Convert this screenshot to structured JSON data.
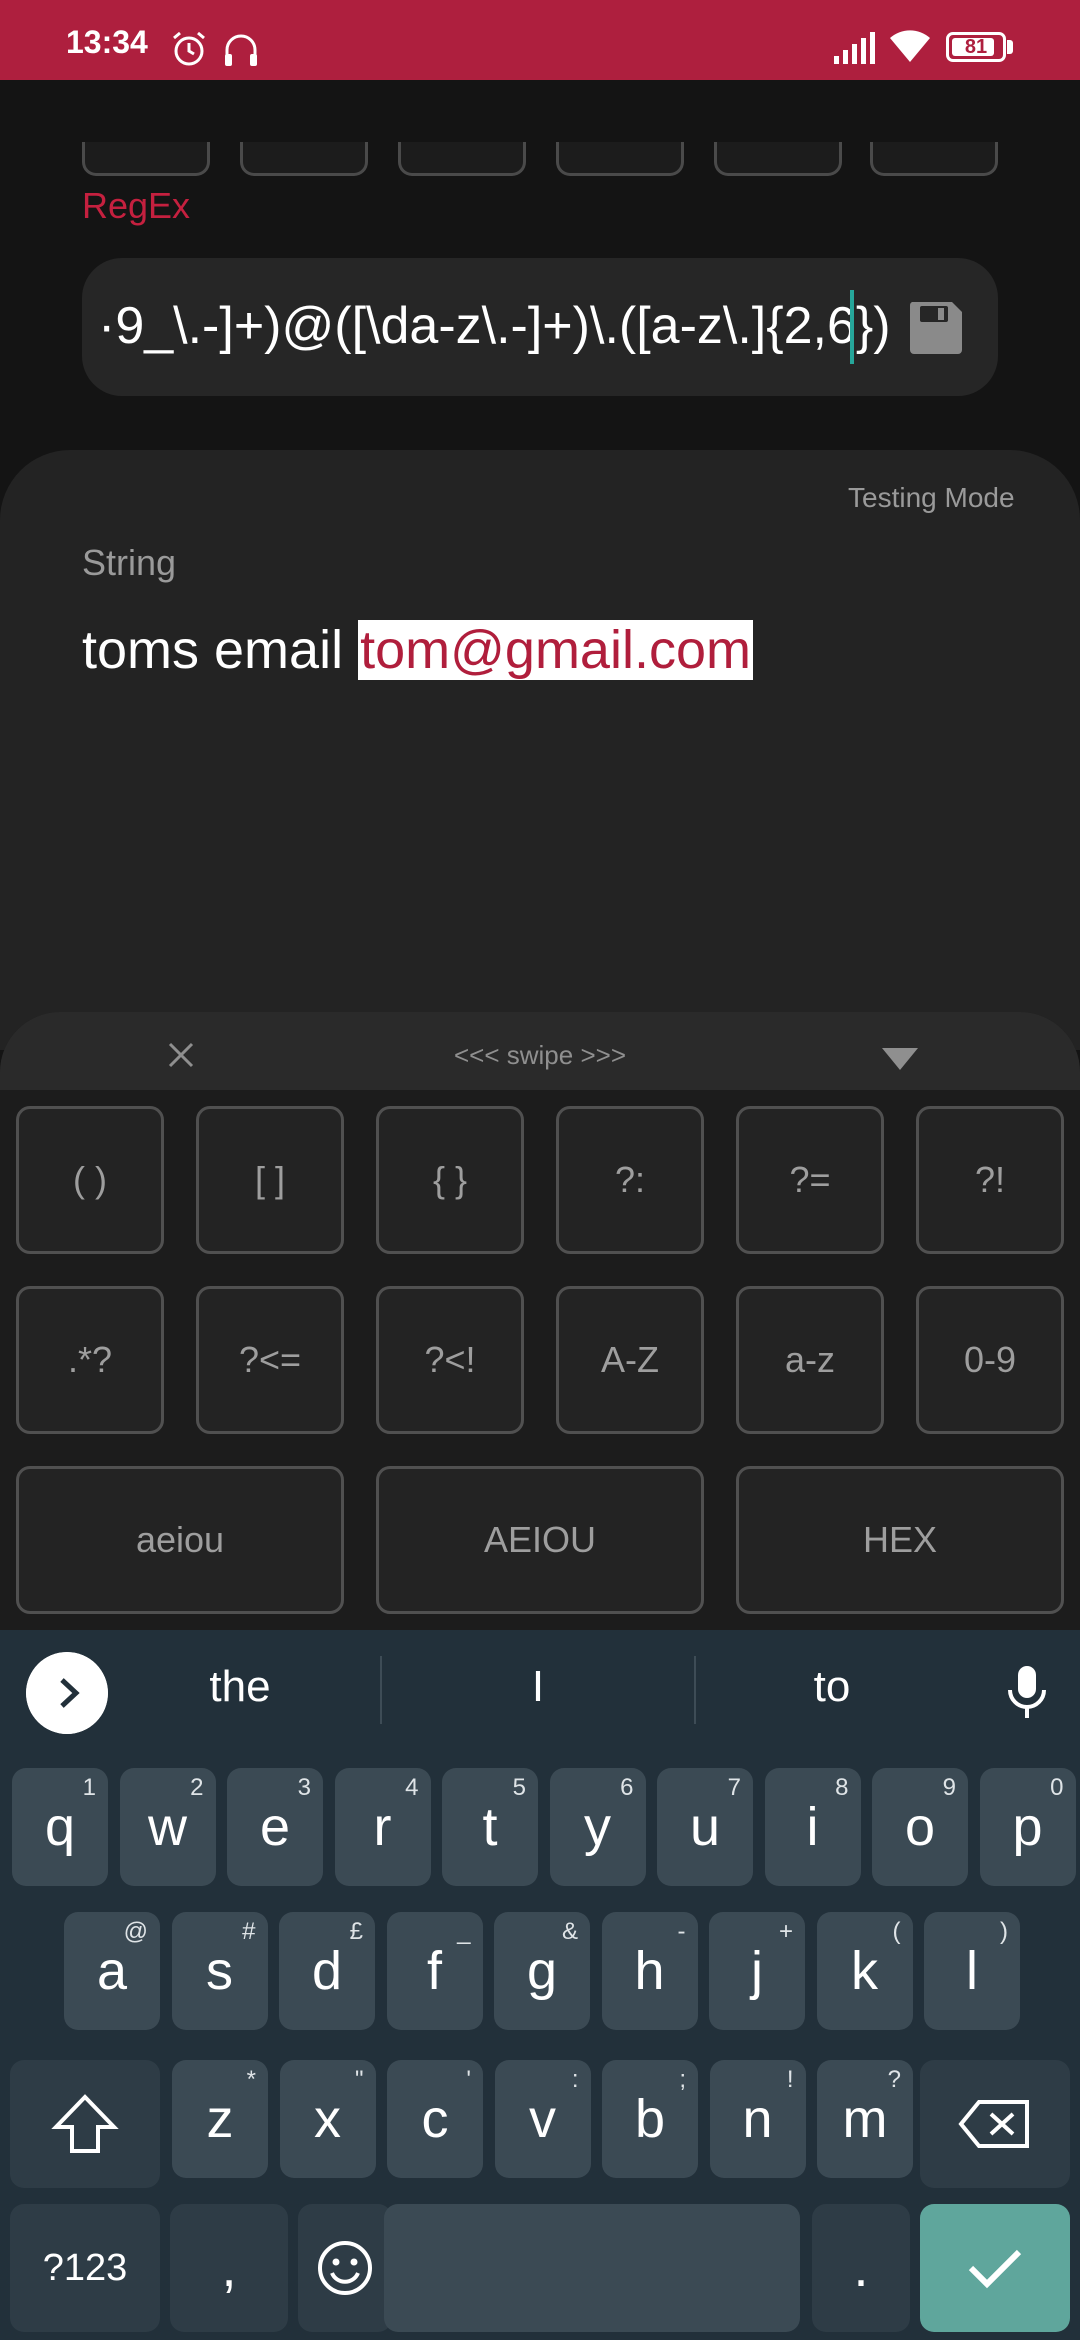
{
  "status_bar": {
    "time": "13:34",
    "battery": "81",
    "bg_color": "#AE1F3E"
  },
  "regex": {
    "label": "RegEx",
    "value": "·9_\\.-]+)@([\\da-z\\.-]+)\\.([a-z\\.]{2,6})",
    "save_icon": "floppy-disk-icon"
  },
  "test": {
    "mode_label": "Testing Mode",
    "string_label": "String",
    "string_prefix": "toms email ",
    "string_match": "tom@gmail.com"
  },
  "helper": {
    "swipe_hint": "<<< swipe >>>",
    "row1": [
      "( )",
      "[ ]",
      "{ }",
      "?:",
      "?=",
      "?!"
    ],
    "row2": [
      ".*?",
      "?<=",
      "?<!",
      "A-Z",
      "a-z",
      "0-9"
    ],
    "row3": [
      "aeiou",
      "AEIOU",
      "HEX"
    ]
  },
  "keyboard": {
    "suggestions": [
      "the",
      "I",
      "to"
    ],
    "row1": [
      {
        "k": "q",
        "h": "1"
      },
      {
        "k": "w",
        "h": "2"
      },
      {
        "k": "e",
        "h": "3"
      },
      {
        "k": "r",
        "h": "4"
      },
      {
        "k": "t",
        "h": "5"
      },
      {
        "k": "y",
        "h": "6"
      },
      {
        "k": "u",
        "h": "7"
      },
      {
        "k": "i",
        "h": "8"
      },
      {
        "k": "o",
        "h": "9"
      },
      {
        "k": "p",
        "h": "0"
      }
    ],
    "row2": [
      {
        "k": "a",
        "h": "@"
      },
      {
        "k": "s",
        "h": "#"
      },
      {
        "k": "d",
        "h": "£"
      },
      {
        "k": "f",
        "h": "_"
      },
      {
        "k": "g",
        "h": "&"
      },
      {
        "k": "h",
        "h": "-"
      },
      {
        "k": "j",
        "h": "+"
      },
      {
        "k": "k",
        "h": "("
      },
      {
        "k": "l",
        "h": ")"
      }
    ],
    "row3": [
      {
        "k": "z",
        "h": "*"
      },
      {
        "k": "x",
        "h": "\""
      },
      {
        "k": "c",
        "h": "'"
      },
      {
        "k": "v",
        "h": ":"
      },
      {
        "k": "b",
        "h": ";"
      },
      {
        "k": "n",
        "h": "!"
      },
      {
        "k": "m",
        "h": "?"
      }
    ],
    "symbols_label": "?123",
    "comma": ",",
    "period": ".",
    "accent_color": "#5FA69C"
  }
}
